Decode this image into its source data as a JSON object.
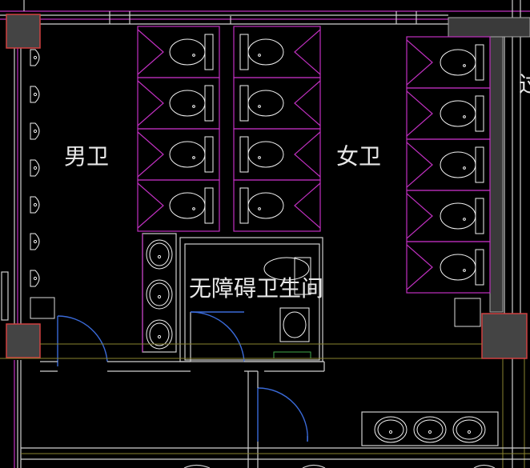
{
  "labels": {
    "mens_restroom": "男卫",
    "womens_restroom": "女卫",
    "accessible_restroom": "无障碍卫生间",
    "edge_fragment": "过"
  },
  "colors": {
    "background": "#000000",
    "partition": "#c030c0",
    "wall": "#cfcfcf",
    "fixture": "#f2f2f2",
    "door": "#3a6ad8",
    "column": "#444444",
    "column_outline": "#d04040",
    "axis_line": "#8a8430",
    "accent_green": "#3fa84a"
  },
  "fixtures": {
    "mens_urinals": 7,
    "mens_toilet_stalls": 8,
    "womens_toilet_stalls": 5,
    "washbasins_mid": 3,
    "washbasins_bottom": 3
  }
}
